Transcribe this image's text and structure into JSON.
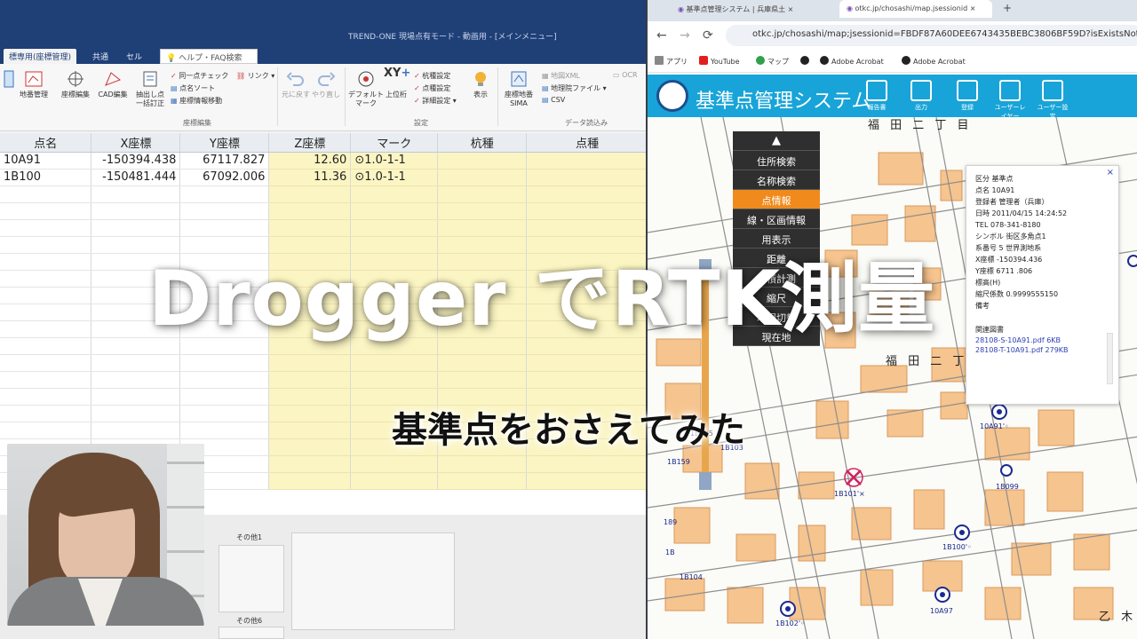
{
  "overlay": {
    "title": "Drogger でRTK測量",
    "subtitle": "基準点をおさえてみた"
  },
  "app": {
    "window_title": "TREND-ONE 現場点有モード - 動画用 - [メインメニュー]",
    "tabs": [
      "標専用(座標管理)",
      "共通",
      "セル",
      "ヘルプ・FAQ検索"
    ],
    "ribbon": {
      "left_items": [
        "地番管理",
        "座標編集",
        "CAD編集",
        "抽出し点 一括訂正"
      ],
      "check_items": [
        "同一点チェック",
        "点名ソート",
        "座標情報移動",
        "リンク"
      ],
      "undo": "元に戻す",
      "redo": "やり直し",
      "default_mark": "デフォルト マーク",
      "upper": "上位桁",
      "settings_items": [
        "杭種設定",
        "点種設定",
        "詳細設定"
      ],
      "display": "表示",
      "sima": "座標地番 SIMA",
      "import_items": [
        "地図XML",
        "地理院ファイル",
        "CSV",
        "OCR"
      ],
      "groups": [
        "座標編集",
        "設定",
        "データ読込み"
      ]
    },
    "grid": {
      "headers": [
        "点名",
        "X座標",
        "Y座標",
        "Z座標",
        "マーク",
        "杭種",
        "点種"
      ],
      "rows": [
        {
          "name": "10A91",
          "x": "-150394.438",
          "y": "67117.827",
          "z": "12.60",
          "mark": "⊙1.0-1-1"
        },
        {
          "name": "1B100",
          "x": "-150481.444",
          "y": "67092.006",
          "z": "11.36",
          "mark": "⊙1.0-1-1"
        }
      ]
    },
    "bottom_labels": [
      "その他1",
      "その他6"
    ]
  },
  "browser": {
    "tabs": [
      "基準点管理システム | 兵庫県土",
      "otkc.jp/chosashi/map.jsessionid"
    ],
    "url": "otkc.jp/chosashi/map;jsessionid=FBDF87A60DEE6743435BEBC3806BF59D?isExistsNotReport",
    "bookmarks": [
      "アプリ",
      "YouTube",
      "マップ",
      "Adobe Acrobat",
      "Adobe Acrobat"
    ],
    "site_title": "基準点管理システム",
    "site_buttons": [
      "報告書",
      "出力",
      "登録",
      "ユーザーレイヤー",
      "ユーザー設定"
    ],
    "menu": [
      "住所検索",
      "名称検索",
      "点情報",
      "線・区画情報",
      "用表示",
      "距離",
      "面積計測",
      "縮尺",
      "地図切替",
      "現在地"
    ],
    "popup": {
      "rows": [
        "区分 基準点",
        "点名 10A91",
        "登録者 管理者（兵庫）",
        "日時 2011/04/15 14:24:52",
        "TEL 078-341-8180",
        "シンボル 街区多角点1",
        "系番号 5 世界測地系",
        "X座標 -150394.436",
        "Y座標 6711 .806",
        "標高(H)",
        "縮尺係数 0.9999555150",
        "備考"
      ],
      "files_label": "関連図書",
      "files": [
        "28108-S-10A91.pdf 6KB",
        "28108-T-10A91.pdf 279KB"
      ],
      "close": "×"
    },
    "map_labels": [
      "10A91'◦",
      "1B105",
      "1B103",
      "1B159",
      "1B101'×",
      "1B099",
      "1B100'◦",
      "1B104",
      "1B102'◦",
      "10A97",
      "189",
      "1B"
    ],
    "streets": [
      "福 田 二 丁 目",
      "福 田 二 丁 目",
      "乙 木"
    ]
  }
}
